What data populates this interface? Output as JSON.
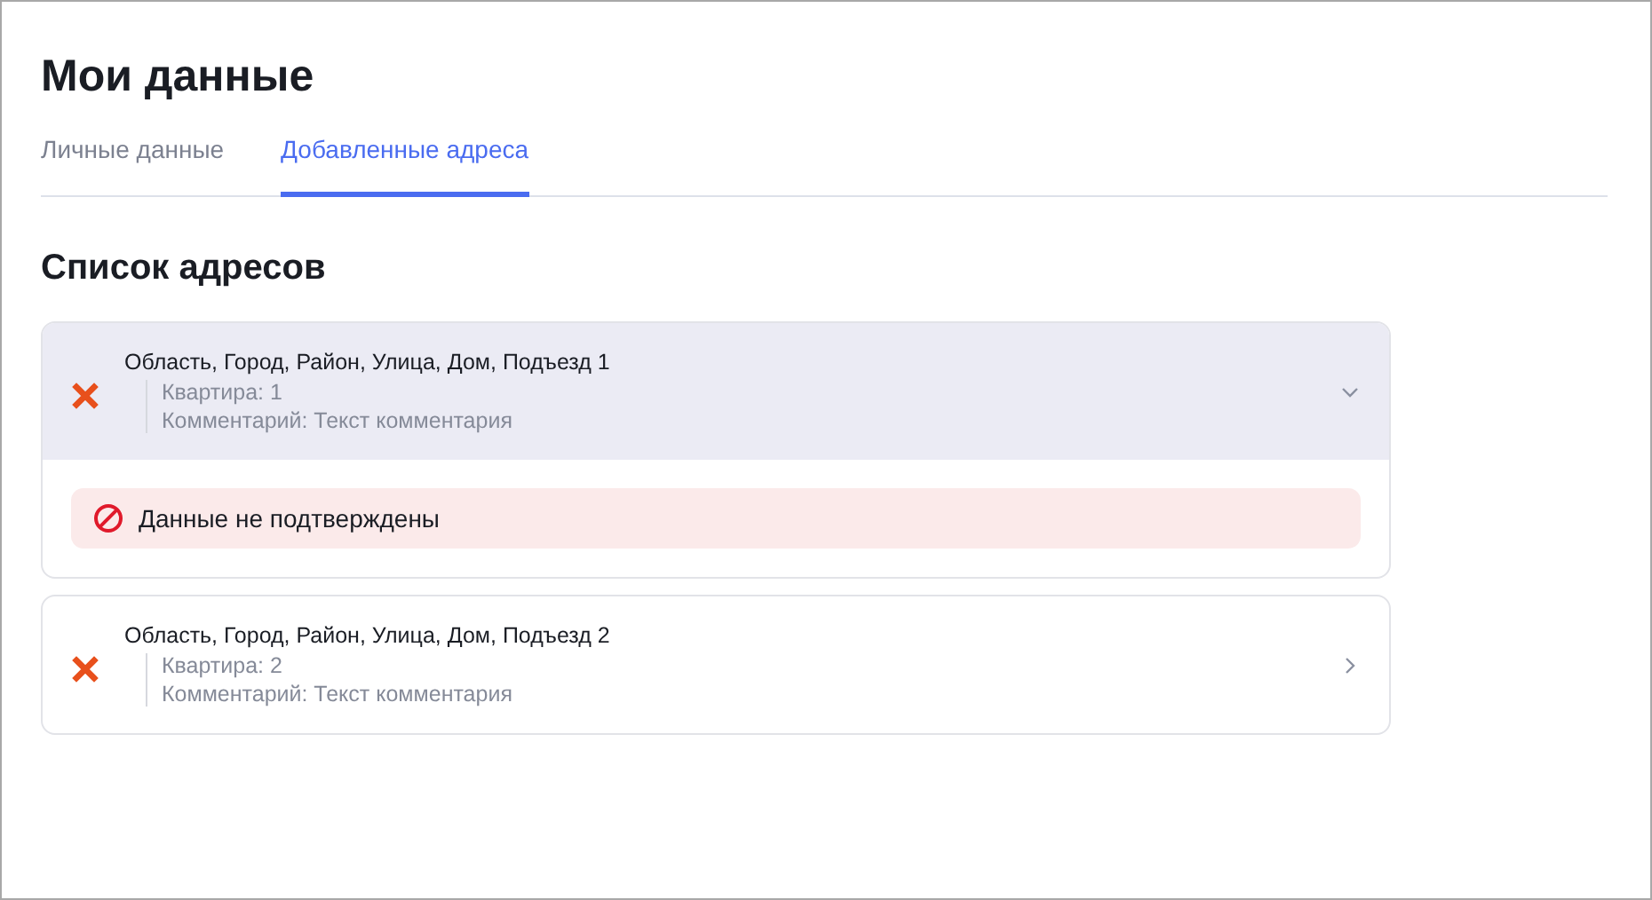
{
  "page": {
    "title": "Мои данные"
  },
  "tabs": [
    {
      "label": "Личные данные",
      "selected": false
    },
    {
      "label": "Добавленные адреса",
      "selected": true
    }
  ],
  "section": {
    "title": "Список адресов"
  },
  "addresses": [
    {
      "address": "Область, Город, Район, Улица, Дом, Подъезд 1",
      "apartment": "Квартира: 1",
      "comment": "Комментарий: Текст комментария",
      "expanded": true,
      "status": "Данные не подтверждены"
    },
    {
      "address": "Область, Город, Район, Улица, Дом, Подъезд 2",
      "apartment": "Квартира: 2",
      "comment": "Комментарий: Текст комментария",
      "expanded": false
    }
  ]
}
